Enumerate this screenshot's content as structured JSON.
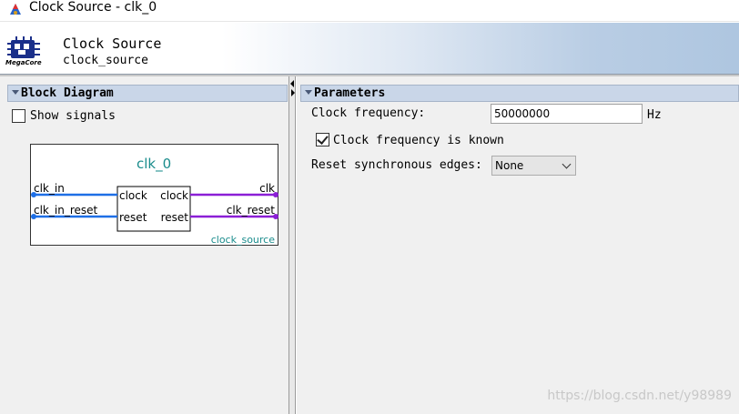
{
  "window": {
    "title": "Clock Source - clk_0",
    "app_icon": "quartus-icon"
  },
  "header": {
    "logo_icon": "megacore-logo-icon",
    "logo_text": "MegaCore",
    "title": "Clock Source",
    "subtitle": "clock_source"
  },
  "block_diagram": {
    "section_title": "Block Diagram",
    "show_signals_label": "Show signals",
    "show_signals_checked": false,
    "instance_name": "clk_0",
    "component_name": "clock_source",
    "inputs": [
      {
        "external": "clk_in",
        "port": "clock"
      },
      {
        "external": "clk_in_reset",
        "port": "reset"
      }
    ],
    "outputs": [
      {
        "port": "clock",
        "external": "clk"
      },
      {
        "port": "reset",
        "external": "clk_reset"
      }
    ],
    "colors": {
      "input_wire": "#1e6fe6",
      "output_wire": "#8b1fd6",
      "title": "#1a8c8c"
    }
  },
  "parameters": {
    "section_title": "Parameters",
    "clock_frequency_label": "Clock frequency:",
    "clock_frequency_value": "50000000",
    "clock_frequency_unit": "Hz",
    "known_label": "Clock frequency is known",
    "known_checked": true,
    "reset_label": "Reset synchronous edges:",
    "reset_value": "None"
  },
  "watermark": "https://blog.csdn.net/y98989"
}
